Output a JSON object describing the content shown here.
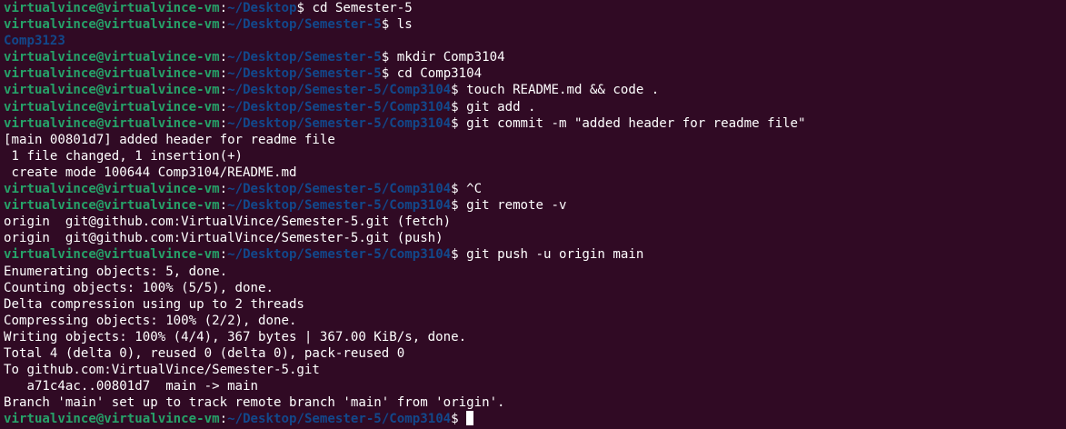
{
  "terminal": {
    "colors": {
      "background": "#300a24",
      "prompt_user": "#26a269",
      "prompt_path": "#12488b",
      "text": "#ffffff"
    },
    "lines": [
      {
        "kind": "prompt",
        "user": "virtualvince@virtualvince-vm",
        "colon": ":",
        "path": "~/Desktop",
        "dollar": "$",
        "cmd": " cd Semester-5"
      },
      {
        "kind": "prompt",
        "user": "virtualvince@virtualvince-vm",
        "colon": ":",
        "path": "~/Desktop/Semester-5",
        "dollar": "$",
        "cmd": " ls"
      },
      {
        "kind": "dir",
        "text": "Comp3123"
      },
      {
        "kind": "prompt",
        "user": "virtualvince@virtualvince-vm",
        "colon": ":",
        "path": "~/Desktop/Semester-5",
        "dollar": "$",
        "cmd": " mkdir Comp3104"
      },
      {
        "kind": "prompt",
        "user": "virtualvince@virtualvince-vm",
        "colon": ":",
        "path": "~/Desktop/Semester-5",
        "dollar": "$",
        "cmd": " cd Comp3104"
      },
      {
        "kind": "prompt",
        "user": "virtualvince@virtualvince-vm",
        "colon": ":",
        "path": "~/Desktop/Semester-5/Comp3104",
        "dollar": "$",
        "cmd": " touch README.md && code ."
      },
      {
        "kind": "prompt",
        "user": "virtualvince@virtualvince-vm",
        "colon": ":",
        "path": "~/Desktop/Semester-5/Comp3104",
        "dollar": "$",
        "cmd": " git add ."
      },
      {
        "kind": "prompt",
        "user": "virtualvince@virtualvince-vm",
        "colon": ":",
        "path": "~/Desktop/Semester-5/Comp3104",
        "dollar": "$",
        "cmd": " git commit -m \"added header for readme file\""
      },
      {
        "kind": "out",
        "text": "[main 00801d7] added header for readme file"
      },
      {
        "kind": "out",
        "text": " 1 file changed, 1 insertion(+)"
      },
      {
        "kind": "out",
        "text": " create mode 100644 Comp3104/README.md"
      },
      {
        "kind": "prompt",
        "user": "virtualvince@virtualvince-vm",
        "colon": ":",
        "path": "~/Desktop/Semester-5/Comp3104",
        "dollar": "$",
        "cmd": " ^C"
      },
      {
        "kind": "prompt",
        "user": "virtualvince@virtualvince-vm",
        "colon": ":",
        "path": "~/Desktop/Semester-5/Comp3104",
        "dollar": "$",
        "cmd": " git remote -v"
      },
      {
        "kind": "out",
        "text": "origin  git@github.com:VirtualVince/Semester-5.git (fetch)"
      },
      {
        "kind": "out",
        "text": "origin  git@github.com:VirtualVince/Semester-5.git (push)"
      },
      {
        "kind": "prompt",
        "user": "virtualvince@virtualvince-vm",
        "colon": ":",
        "path": "~/Desktop/Semester-5/Comp3104",
        "dollar": "$",
        "cmd": " git push -u origin main"
      },
      {
        "kind": "out",
        "text": "Enumerating objects: 5, done."
      },
      {
        "kind": "out",
        "text": "Counting objects: 100% (5/5), done."
      },
      {
        "kind": "out",
        "text": "Delta compression using up to 2 threads"
      },
      {
        "kind": "out",
        "text": "Compressing objects: 100% (2/2), done."
      },
      {
        "kind": "out",
        "text": "Writing objects: 100% (4/4), 367 bytes | 367.00 KiB/s, done."
      },
      {
        "kind": "out",
        "text": "Total 4 (delta 0), reused 0 (delta 0), pack-reused 0"
      },
      {
        "kind": "out",
        "text": "To github.com:VirtualVince/Semester-5.git"
      },
      {
        "kind": "out",
        "text": "   a71c4ac..00801d7  main -> main"
      },
      {
        "kind": "out",
        "text": "Branch 'main' set up to track remote branch 'main' from 'origin'."
      },
      {
        "kind": "prompt",
        "user": "virtualvince@virtualvince-vm",
        "colon": ":",
        "path": "~/Desktop/Semester-5/Comp3104",
        "dollar": "$",
        "cmd": " ",
        "cursor": true
      }
    ]
  }
}
